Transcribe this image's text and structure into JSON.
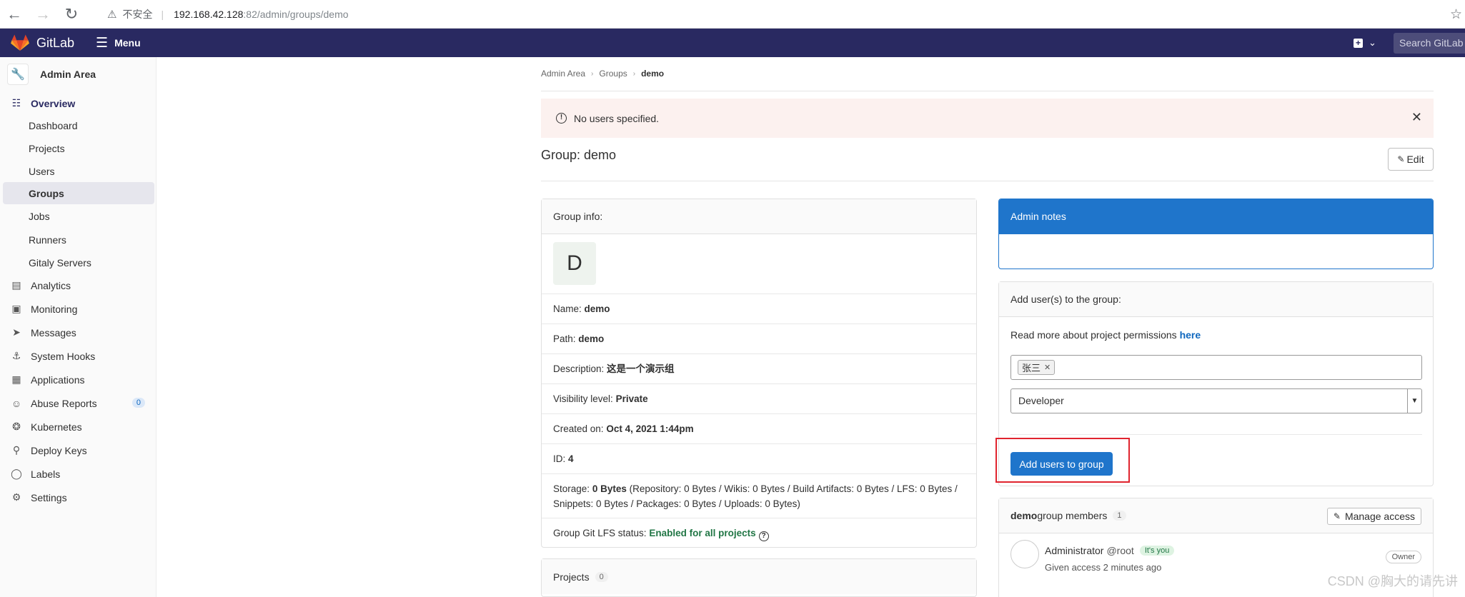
{
  "browser": {
    "insecure_label": "不安全",
    "url_host": "192.168.42.128",
    "url_path": ":82/admin/groups/demo"
  },
  "topbar": {
    "logo_text": "GitLab",
    "menu_label": "Menu",
    "search_placeholder": "Search GitLab"
  },
  "sidebar": {
    "title": "Admin Area",
    "items": [
      {
        "label": "Overview",
        "icon": "overview-icon"
      },
      {
        "label": "Dashboard"
      },
      {
        "label": "Projects"
      },
      {
        "label": "Users"
      },
      {
        "label": "Groups"
      },
      {
        "label": "Jobs"
      },
      {
        "label": "Runners"
      },
      {
        "label": "Gitaly Servers"
      },
      {
        "label": "Analytics",
        "icon": "chart-icon"
      },
      {
        "label": "Monitoring",
        "icon": "monitor-icon"
      },
      {
        "label": "Messages",
        "icon": "megaphone-icon"
      },
      {
        "label": "System Hooks",
        "icon": "hook-icon"
      },
      {
        "label": "Applications",
        "icon": "grid-icon"
      },
      {
        "label": "Abuse Reports",
        "icon": "face-icon",
        "badge": "0"
      },
      {
        "label": "Kubernetes",
        "icon": "kubernetes-icon"
      },
      {
        "label": "Deploy Keys",
        "icon": "key-icon"
      },
      {
        "label": "Labels",
        "icon": "label-icon"
      },
      {
        "label": "Settings",
        "icon": "gear-icon"
      }
    ]
  },
  "breadcrumb": [
    "Admin Area",
    "Groups",
    "demo"
  ],
  "alert": {
    "message": "No users specified."
  },
  "page": {
    "title": "Group: demo",
    "edit_label": "Edit"
  },
  "group_info": {
    "header": "Group info:",
    "avatar_letter": "D",
    "name_label": "Name:",
    "name": "demo",
    "path_label": "Path:",
    "path": "demo",
    "description_label": "Description:",
    "description": "这是一个演示组",
    "visibility_label": "Visibility level:",
    "visibility": "Private",
    "created_label": "Created on:",
    "created": "Oct 4, 2021 1:44pm",
    "id_label": "ID:",
    "id": "4",
    "storage_label": "Storage:",
    "storage_total": "0 Bytes",
    "storage_detail_1": " (Repository: 0 Bytes / Wikis: 0 Bytes / Build Artifacts: 0 Bytes / LFS: 0 Bytes /",
    "storage_detail_2": "Snippets: 0 Bytes / Packages: 0 Bytes / Uploads: 0 Bytes)",
    "lfs_label": "Group Git LFS status:",
    "lfs_status": "Enabled for all projects"
  },
  "projects": {
    "label": "Projects",
    "count": "0"
  },
  "admin_notes": {
    "header": "Admin notes"
  },
  "add_users": {
    "header": "Add user(s) to the group:",
    "permissions_text": "Read more about project permissions ",
    "permissions_link": "here",
    "selected_user": "张三",
    "role": "Developer",
    "submit_label": "Add users to group"
  },
  "members": {
    "group_name": "demo",
    "header_suffix": " group members",
    "count": "1",
    "manage_label": "Manage access",
    "list": [
      {
        "name": "Administrator",
        "handle": "@root",
        "badge": "It's you",
        "access": "Given access 2 minutes ago",
        "role": "Owner"
      }
    ]
  },
  "watermark": "CSDN @胸大的请先讲"
}
